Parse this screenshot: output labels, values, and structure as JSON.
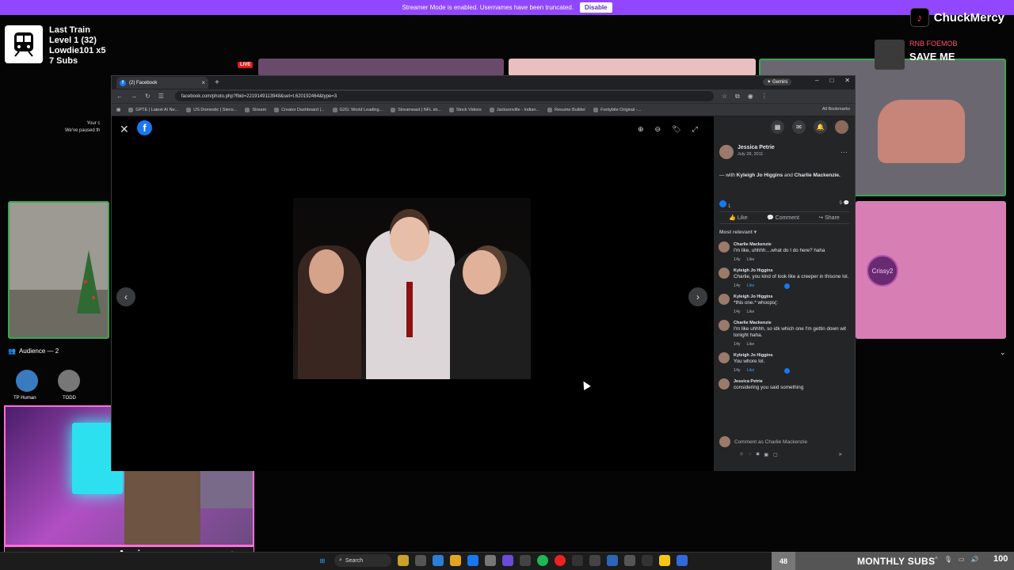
{
  "banner": {
    "text": "Streamer Mode is enabled. Usernames have been truncated.",
    "button": "Disable"
  },
  "stats": {
    "lines": [
      "Last Train",
      "Level 1 (32)",
      "Lowdie101 x5",
      "7 Subs"
    ]
  },
  "notice": {
    "line1": "Your c",
    "line2": "We've paused th"
  },
  "tiktok": {
    "handle": "ChuckMercy"
  },
  "rnb": {
    "label": "RNB FOEMOB",
    "save": "SAVE ME"
  },
  "live": "LIVE",
  "pinkavatar": "Crissy2",
  "audience": {
    "label": "Audience — 2",
    "members": [
      "TP Human",
      "TODD"
    ]
  },
  "webcam": {
    "name": "Anxi"
  },
  "browser": {
    "tab": {
      "title": "(2) Facebook"
    },
    "gemini": "Gemini",
    "url": "facebook.com/photo.php?fbid=2219149113948&set=t.620192464&type=3",
    "bookmarks": [
      "GPTE | Latest AI Ne...",
      "US Domestic | Stens...",
      "Stream",
      "Creator Dashboard |...",
      "G2G: World Leading...",
      "Streameast | NFL str...",
      "Stock Videos",
      "Jacksonville - Indian...",
      "Resume Builder",
      "Footybite Original -..."
    ],
    "all_bookmarks": "All Bookmarks"
  },
  "panel": {
    "poster": {
      "name": "Jessica Petrie",
      "date": "July 28, 2011 ·"
    },
    "with_prefix": "— with ",
    "with_names": [
      "Kyleigh Jo Higgins",
      "and",
      "Charlie Mackenzie."
    ],
    "reactions": {
      "likes": "1",
      "comments": "9"
    },
    "actions": [
      "Like",
      "Comment",
      "Share"
    ],
    "sort": "Most relevant",
    "comments": [
      {
        "name": "Charlie Mackenzie",
        "text": "I'm like, uhhhh....what do I do here? haha",
        "age": "14y",
        "like": "Like",
        "liked": false,
        "badge": false
      },
      {
        "name": "Kyleigh Jo Higgins",
        "text": "Charlie, you kind of look like a creeper in thisone lol.",
        "age": "14y",
        "like": "Like",
        "liked": true,
        "badge": true
      },
      {
        "name": "Kyleigh Jo Higgins",
        "text": "*this one.* whoops(:",
        "age": "14y",
        "like": "Like",
        "liked": false,
        "badge": false
      },
      {
        "name": "Charlie Mackenzie",
        "text": "I'm like uhhhh, so idk which one I'm gettin down wit tonight haha.",
        "age": "14y",
        "like": "Like",
        "liked": false,
        "badge": false
      },
      {
        "name": "Kyleigh Jo Higgins",
        "text": "You whore lol.",
        "age": "14y",
        "like": "Like",
        "liked": true,
        "badge": true
      },
      {
        "name": "Jessica Petrie",
        "text": "considering you said something",
        "age": "",
        "like": "",
        "liked": false,
        "badge": false
      }
    ],
    "compose_placeholder": "Comment as Charlie Mackenzie"
  },
  "taskbar": {
    "search": "Search",
    "subs_count": "48",
    "subs_label": "MONTHLY SUBS",
    "tray_value": "100"
  },
  "colors": {
    "twitch": "#9147ff",
    "facebook": "#1877f2",
    "webcam_border": "#ff6fd8",
    "green_border": "#3aa655"
  }
}
